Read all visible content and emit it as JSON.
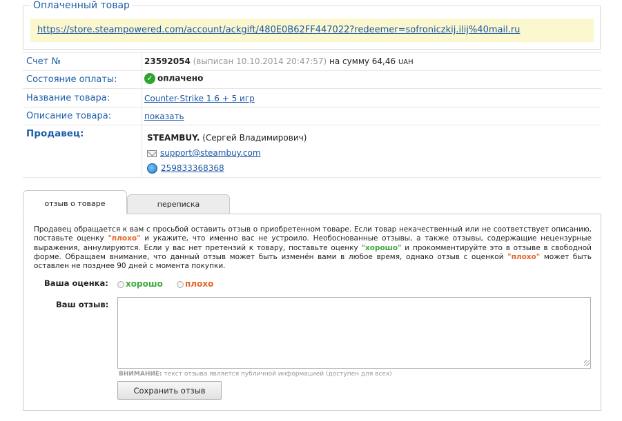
{
  "paid": {
    "legend": "Оплаченный товар",
    "link": "https://store.steampowered.com/account/ackgift/480E0B62FF447022?redeemer=sofroniczkij.ilij%40mail.ru"
  },
  "invoice": {
    "label": "Счет №",
    "number": "23592054",
    "issued": "(выписан 10.10.2014 20:47:57)",
    "sum_text": "на сумму 64,46",
    "currency": "UAH"
  },
  "payment": {
    "label": "Состояние оплаты:",
    "status": "оплачено",
    "status_icon": "check-circle",
    "status_color": "#2fa32f"
  },
  "product": {
    "label": "Название товара:",
    "name": "Counter-Strike 1.6 + 5 игр"
  },
  "description": {
    "label": "Описание товара:",
    "link": "показать"
  },
  "seller": {
    "label": "Продавец:",
    "name": "STEAMBUY.",
    "person": "(Сергей Владимирович)",
    "email": "support@steambuy.com",
    "wmid": "259833368368"
  },
  "tabs": [
    {
      "label": "отзыв о товаре",
      "active": true
    },
    {
      "label": "переписка",
      "active": false
    }
  ],
  "review": {
    "notice_p1": "Продавец обращается к вам с просьбой оставить отзыв о приобретенном товаре. Если товар некачественный или не соответствует описанию, поставьте оценку ",
    "bad_q": "\"плохо\"",
    "notice_p2": " и укажите, что именно вас не устроило. Необоснованные отзывы, а также отзывы, содержащие нецензурные выражения, аннулируются. Если у вас нет претензий к товару, поставьте оценку ",
    "good_q": "\"хорошо\"",
    "notice_p3": " и прокомментируйте это в отзыве в свободной форме. Обращаем внимание, что данный отзыв может быть изменён вами в любое время, однако отзыв с оценкой ",
    "bad_q2": "\"плохо\"",
    "notice_p4": " может быть оставлен не позднее 90 дней с момента покупки.",
    "rating_label": "Ваша оценка:",
    "good": "хорошо",
    "bad": "плохо",
    "review_label": "Ваш отзыв:",
    "textarea_value": "",
    "warning_bold": "ВНИМАНИЕ:",
    "warning_text": "текст отзыва является публичной информацией (доступен для всех)",
    "save": "Сохранить отзыв"
  }
}
